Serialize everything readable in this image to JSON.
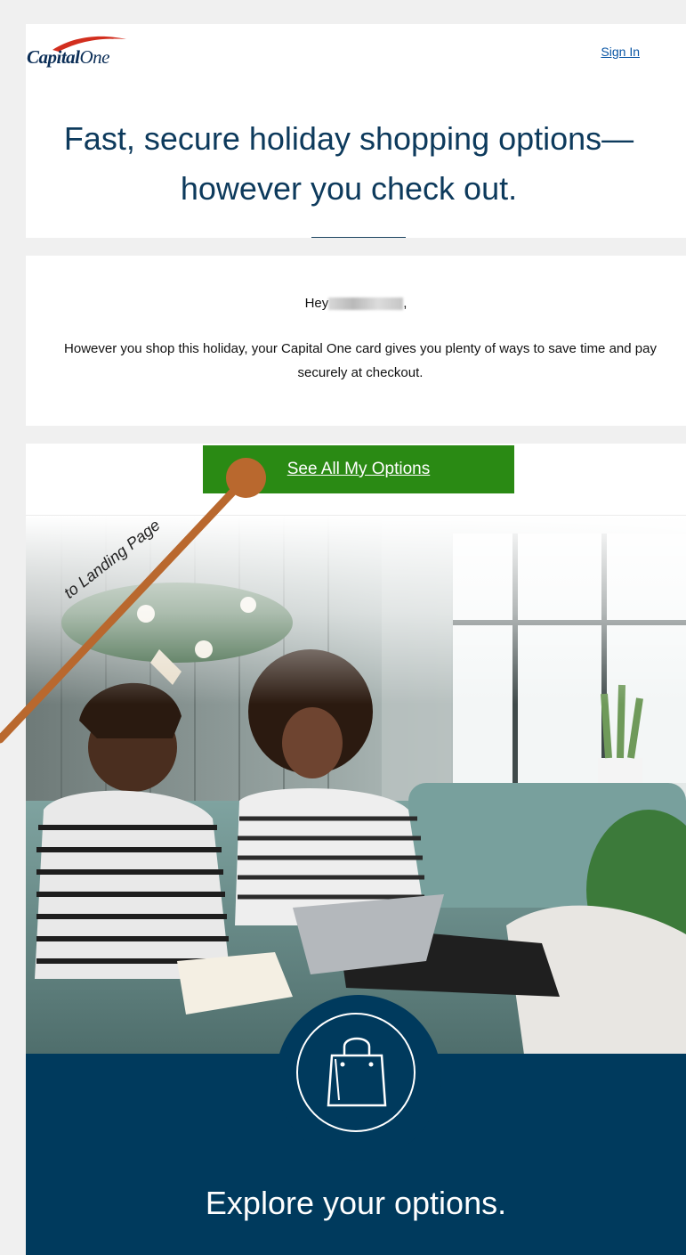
{
  "brand": {
    "logo_text_bold": "Capital",
    "logo_text_rest": "One"
  },
  "header": {
    "sign_in_label": "Sign In"
  },
  "headline": "Fast, secure holiday shopping options—however you check out.",
  "greeting": {
    "prefix": "Hey",
    "suffix": ","
  },
  "body_text": "However you shop this holiday, your Capital One card gives you plenty of ways to save time and pay securely at checkout.",
  "cta": {
    "label": "See All My Options",
    "color": "#2a8a14"
  },
  "promo": {
    "title": "Explore your options.",
    "icon": "shopping-bag-icon",
    "color": "#003a5d"
  },
  "annotation": {
    "label": "to Landing Page",
    "color": "#b9682e"
  }
}
